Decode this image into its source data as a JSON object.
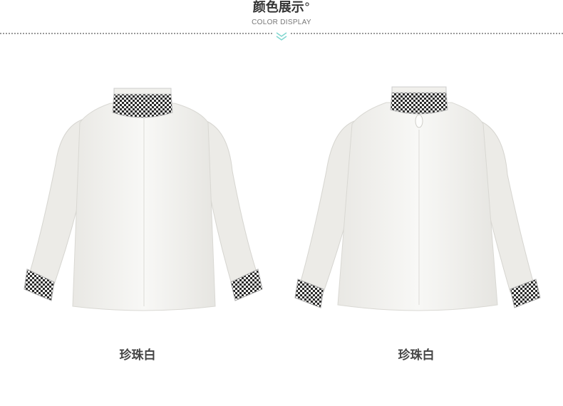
{
  "header": {
    "title": "颜色展示",
    "title_mark": "°",
    "subtitle": "COLOR DISPLAY",
    "divider_icon": "double-chevron-down-icon",
    "accent_color": "#7fd6cf"
  },
  "products": [
    {
      "view": "front",
      "image_icon": "blouse-front-image",
      "label": "珍珠白"
    },
    {
      "view": "back",
      "image_icon": "blouse-back-image",
      "label": "珍珠白"
    }
  ],
  "colors": {
    "fabric": "#f2f1ee",
    "embroidery": "#2a2a2a"
  }
}
